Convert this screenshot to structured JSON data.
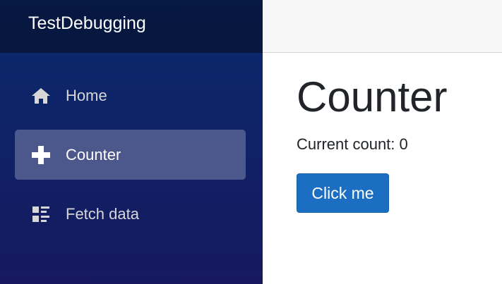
{
  "app": {
    "brand": "TestDebugging"
  },
  "nav": {
    "items": [
      {
        "label": "Home",
        "icon": "home-icon"
      },
      {
        "label": "Counter",
        "icon": "plus-icon",
        "active": true
      },
      {
        "label": "Fetch data",
        "icon": "list-rich-icon"
      }
    ]
  },
  "page": {
    "title": "Counter",
    "count_text": "Current count: 0",
    "button_label": "Click me"
  },
  "colors": {
    "sidebar_top": "#0a2a6e",
    "sidebar_bottom": "#16195e",
    "button": "#1b6ec2",
    "text": "#212529"
  }
}
